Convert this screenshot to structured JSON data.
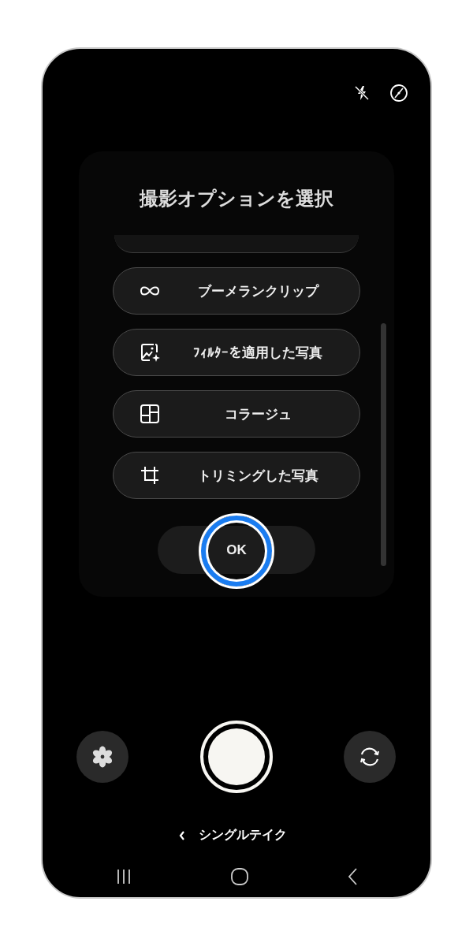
{
  "dialog": {
    "title": "撮影オプションを選択",
    "options": [
      {
        "kind": "boomerang",
        "label": "ブーメランクリップ"
      },
      {
        "kind": "filter",
        "label": "ﾌｨﾙﾀｰを適用した写真"
      },
      {
        "kind": "collage",
        "label": "コラージュ"
      },
      {
        "kind": "crop",
        "label": "トリミングした写真"
      }
    ],
    "ok_button": {
      "label": "OK",
      "focused": true
    }
  },
  "mode_switcher": {
    "label": "シングルテイク"
  }
}
